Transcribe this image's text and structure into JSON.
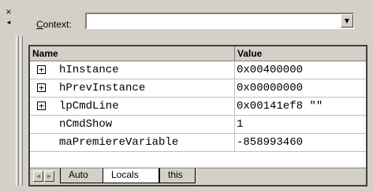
{
  "window": {
    "close_glyph": "×",
    "pin_glyph": "◂"
  },
  "context": {
    "label_prefix": "C",
    "label_rest": "ontext:",
    "value": "",
    "dropdown_glyph": "▼"
  },
  "grid": {
    "columns": [
      "Name",
      "Value"
    ],
    "rows": [
      {
        "expander": "+",
        "name": "hInstance",
        "value": "0x00400000"
      },
      {
        "expander": "+",
        "name": "hPrevInstance",
        "value": "0x00000000"
      },
      {
        "expander": "+",
        "name": "lpCmdLine",
        "value": "0x00141ef8 \"\""
      },
      {
        "expander": "",
        "name": "nCmdShow",
        "value": "1"
      },
      {
        "expander": "",
        "name": "maPremiereVariable",
        "value": "-858993460"
      }
    ]
  },
  "tabs": {
    "scroll_left": "◀",
    "scroll_right": "▶",
    "items": [
      "Auto",
      "Locals",
      "this"
    ],
    "active": "Locals"
  }
}
